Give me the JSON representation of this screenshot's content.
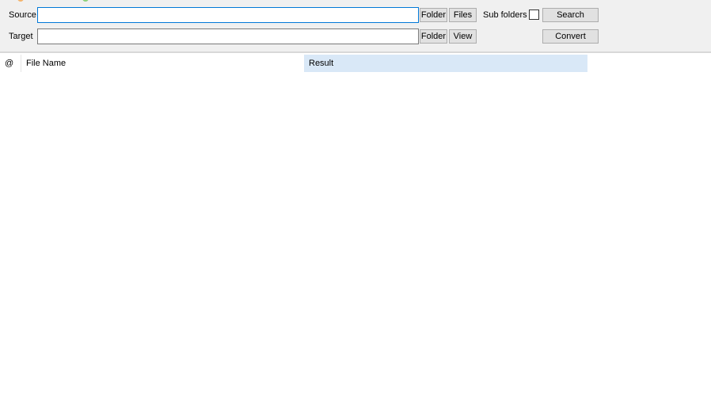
{
  "colors": {
    "accent": "#0078d7",
    "result_header": "#d9e8f7"
  },
  "toolbar": {
    "source_label": "Source",
    "target_label": "Target",
    "source_value": "",
    "target_value": "",
    "source_folder": "Folder",
    "files": "Files",
    "sub_folders": "Sub folders",
    "search": "Search",
    "target_folder": "Folder",
    "view": "View",
    "convert": "Convert"
  },
  "table": {
    "columns": [
      "@",
      "File Name",
      "Result"
    ],
    "rows": []
  }
}
